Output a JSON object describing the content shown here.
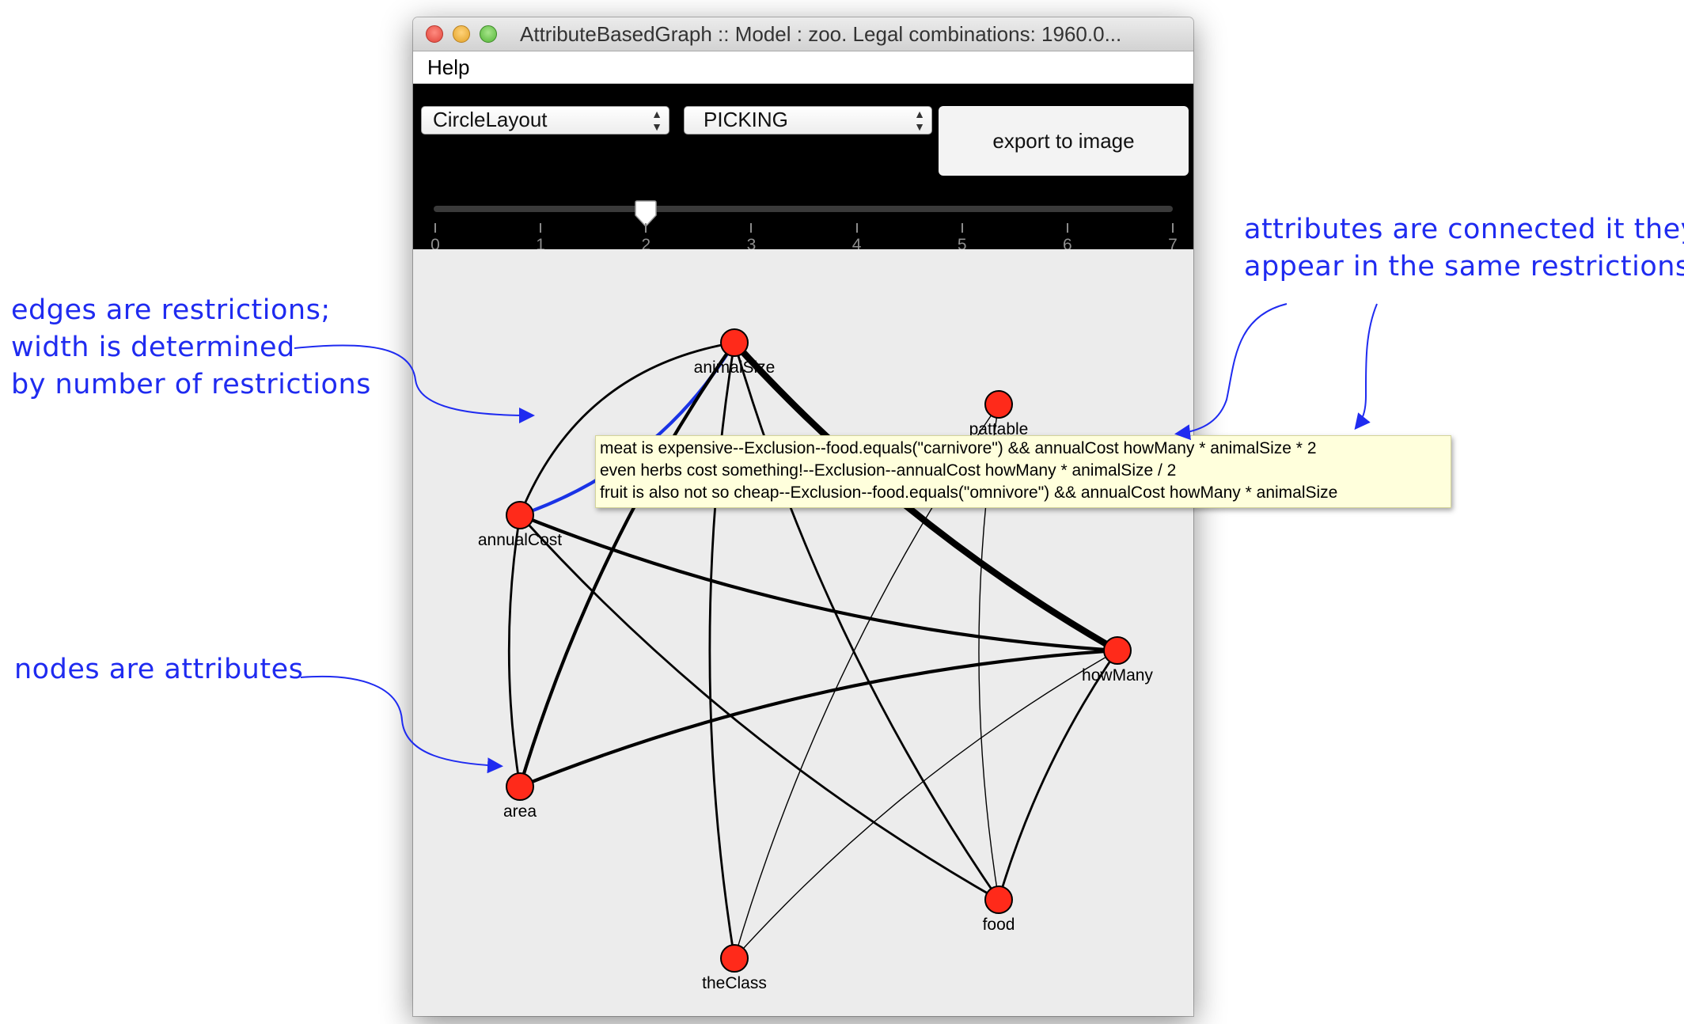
{
  "window": {
    "title": "AttributeBasedGraph :: Model : zoo. Legal combinations: 1960.0...",
    "menu": [
      "Help"
    ]
  },
  "toolbar": {
    "layout_select": "CircleLayout",
    "mode_select": "PICKING",
    "export_label": "export to image",
    "slider": {
      "min": 0,
      "max": 7,
      "value": 2,
      "tick_labels": [
        "0",
        "1",
        "2",
        "3",
        "4",
        "5",
        "6",
        "7"
      ]
    }
  },
  "graph": {
    "nodes": [
      {
        "id": "animalSize",
        "label": "animalSize"
      },
      {
        "id": "pattable",
        "label": "pattable"
      },
      {
        "id": "annualCost",
        "label": "annualCost"
      },
      {
        "id": "howMany",
        "label": "howMany"
      },
      {
        "id": "area",
        "label": "area"
      },
      {
        "id": "food",
        "label": "food"
      },
      {
        "id": "theClass",
        "label": "theClass"
      }
    ],
    "node_color": "#ff2a1a",
    "edge_color": "#000000",
    "selected_edge_color": "#1a33e6",
    "edges": [
      {
        "from": "animalSize",
        "to": "annualCost",
        "weight": 3,
        "selected": true
      },
      {
        "from": "animalSize",
        "to": "howMany",
        "weight": 6
      },
      {
        "from": "animalSize",
        "to": "area",
        "weight": 3
      },
      {
        "from": "animalSize",
        "to": "annualCost",
        "weight": 2,
        "curve": true
      },
      {
        "from": "animalSize",
        "to": "theClass",
        "weight": 2
      },
      {
        "from": "animalSize",
        "to": "food",
        "weight": 2
      },
      {
        "from": "annualCost",
        "to": "howMany",
        "weight": 3
      },
      {
        "from": "annualCost",
        "to": "area",
        "weight": 2
      },
      {
        "from": "annualCost",
        "to": "food",
        "weight": 2
      },
      {
        "from": "howMany",
        "to": "area",
        "weight": 3
      },
      {
        "from": "howMany",
        "to": "food",
        "weight": 2
      },
      {
        "from": "howMany",
        "to": "theClass",
        "weight": 1
      },
      {
        "from": "pattable",
        "to": "theClass",
        "weight": 1
      },
      {
        "from": "pattable",
        "to": "food",
        "weight": 1
      }
    ]
  },
  "tooltip": [
    "meat is expensive--Exclusion--food.equals(\"carnivore\") && annualCost howMany * animalSize * 2",
    "even herbs cost something!--Exclusion--annualCost howMany * animalSize / 2",
    "fruit is also not so cheap--Exclusion--food.equals(\"omnivore\") && annualCost howMany * animalSize"
  ],
  "annotations": {
    "edges": "edges are restrictions;\nwidth is determined\nby number of restrictions",
    "nodes": "nodes are attributes",
    "connected": "attributes are connected it they\nappear in the same restrictions",
    "color": "#1f2bf0"
  }
}
